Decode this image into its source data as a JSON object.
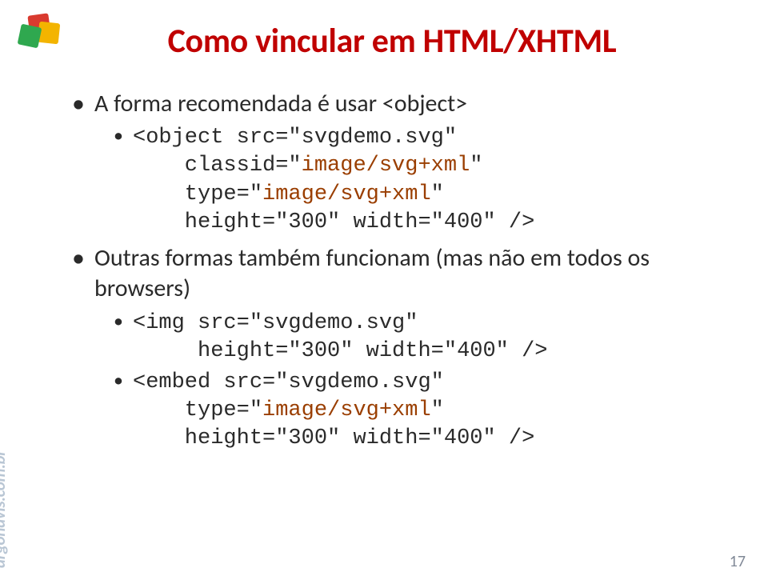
{
  "title": "Como vincular em HTML/XHTML",
  "bullets": {
    "b1": "A forma recomendada é usar <object>",
    "b1_code_l1a": "<object src=\"svgdemo.svg\"",
    "b1_code_l2_pre": "    classid=\"",
    "b1_code_l2_kw": "image/svg+xml",
    "b1_code_l2_post": "\"",
    "b1_code_l3_pre": "    type=\"",
    "b1_code_l3_kw": "image/svg+xml",
    "b1_code_l3_post": "\"",
    "b1_code_l4": "    height=\"300\" width=\"400\" />",
    "b2": "Outras formas também funcionam (mas não em todos os browsers)",
    "b2_code1_l1": "<img src=\"svgdemo.svg\"",
    "b2_code1_l2": "     height=\"300\" width=\"400\" />",
    "b2_code2_l1": "<embed src=\"svgdemo.svg\"",
    "b2_code2_l2_pre": "    type=\"",
    "b2_code2_l2_kw": "image/svg+xml",
    "b2_code2_l2_post": "\"",
    "b2_code2_l3": "    height=\"300\" width=\"400\" />"
  },
  "watermark": "argonavis.com.br",
  "pagenum": "17"
}
